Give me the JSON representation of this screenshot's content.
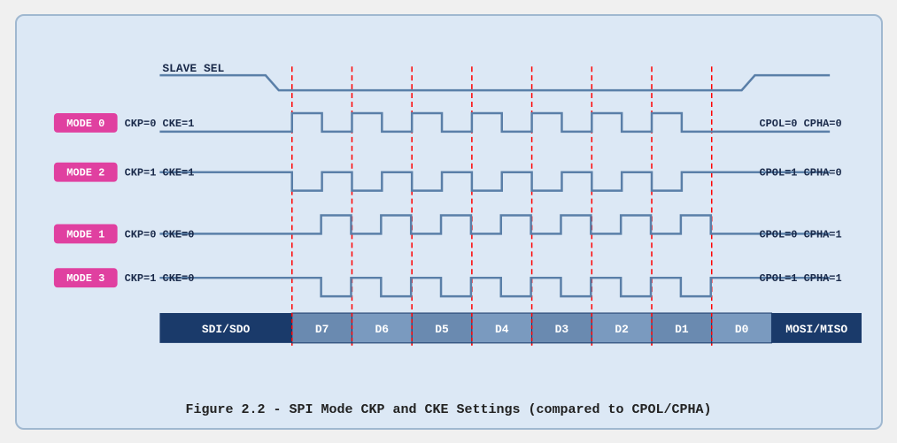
{
  "caption": "Figure 2.2 - SPI Mode CKP and CKE Settings (compared to CPOL/CPHA)",
  "modes": [
    {
      "label": "MODE 0",
      "ckp": "CKP=0",
      "cke": "CKE=1",
      "cpol": "CPOL=0",
      "cpha": "CPHA=0"
    },
    {
      "label": "MODE 2",
      "ckp": "CKP=1",
      "cke": "CKE=1",
      "cpol": "CPOL=1",
      "cpha": "CPHA=0"
    },
    {
      "label": "MODE 1",
      "ckp": "CKP=0",
      "cke": "CKE=0",
      "cpol": "CPOL=0",
      "cpha": "CPHA=1"
    },
    {
      "label": "MODE 3",
      "ckp": "CKP=1",
      "cke": "CKE=0",
      "cpol": "CPOL=1",
      "cpha": "CPHA=1"
    }
  ],
  "slave_sel_label": "SLAVE SEL",
  "data_bits": [
    "D7",
    "D6",
    "D5",
    "D4",
    "D3",
    "D2",
    "D1",
    "D0"
  ],
  "sdi_sdo": "SDI/SDO",
  "mosi_miso": "MOSI/MISO"
}
